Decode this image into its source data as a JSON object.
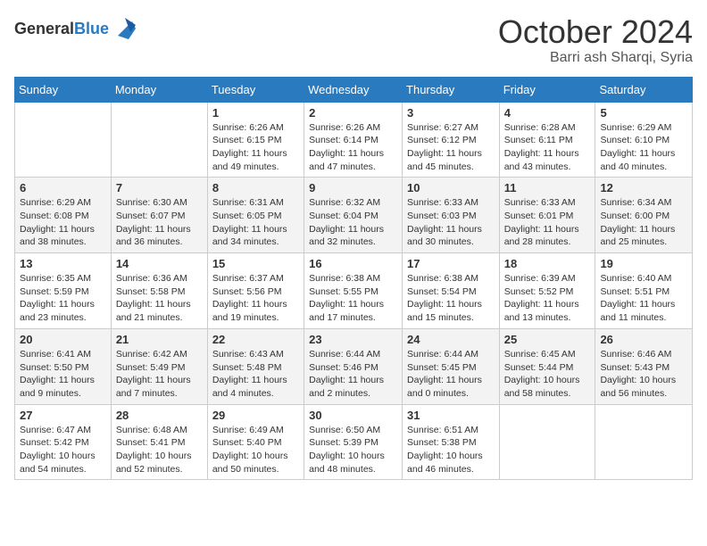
{
  "header": {
    "logo_general": "General",
    "logo_blue": "Blue",
    "month": "October 2024",
    "location": "Barri ash Sharqi, Syria"
  },
  "weekdays": [
    "Sunday",
    "Monday",
    "Tuesday",
    "Wednesday",
    "Thursday",
    "Friday",
    "Saturday"
  ],
  "weeks": [
    [
      {
        "day": null
      },
      {
        "day": null
      },
      {
        "day": 1,
        "sunrise": "Sunrise: 6:26 AM",
        "sunset": "Sunset: 6:15 PM",
        "daylight": "Daylight: 11 hours and 49 minutes."
      },
      {
        "day": 2,
        "sunrise": "Sunrise: 6:26 AM",
        "sunset": "Sunset: 6:14 PM",
        "daylight": "Daylight: 11 hours and 47 minutes."
      },
      {
        "day": 3,
        "sunrise": "Sunrise: 6:27 AM",
        "sunset": "Sunset: 6:12 PM",
        "daylight": "Daylight: 11 hours and 45 minutes."
      },
      {
        "day": 4,
        "sunrise": "Sunrise: 6:28 AM",
        "sunset": "Sunset: 6:11 PM",
        "daylight": "Daylight: 11 hours and 43 minutes."
      },
      {
        "day": 5,
        "sunrise": "Sunrise: 6:29 AM",
        "sunset": "Sunset: 6:10 PM",
        "daylight": "Daylight: 11 hours and 40 minutes."
      }
    ],
    [
      {
        "day": 6,
        "sunrise": "Sunrise: 6:29 AM",
        "sunset": "Sunset: 6:08 PM",
        "daylight": "Daylight: 11 hours and 38 minutes."
      },
      {
        "day": 7,
        "sunrise": "Sunrise: 6:30 AM",
        "sunset": "Sunset: 6:07 PM",
        "daylight": "Daylight: 11 hours and 36 minutes."
      },
      {
        "day": 8,
        "sunrise": "Sunrise: 6:31 AM",
        "sunset": "Sunset: 6:05 PM",
        "daylight": "Daylight: 11 hours and 34 minutes."
      },
      {
        "day": 9,
        "sunrise": "Sunrise: 6:32 AM",
        "sunset": "Sunset: 6:04 PM",
        "daylight": "Daylight: 11 hours and 32 minutes."
      },
      {
        "day": 10,
        "sunrise": "Sunrise: 6:33 AM",
        "sunset": "Sunset: 6:03 PM",
        "daylight": "Daylight: 11 hours and 30 minutes."
      },
      {
        "day": 11,
        "sunrise": "Sunrise: 6:33 AM",
        "sunset": "Sunset: 6:01 PM",
        "daylight": "Daylight: 11 hours and 28 minutes."
      },
      {
        "day": 12,
        "sunrise": "Sunrise: 6:34 AM",
        "sunset": "Sunset: 6:00 PM",
        "daylight": "Daylight: 11 hours and 25 minutes."
      }
    ],
    [
      {
        "day": 13,
        "sunrise": "Sunrise: 6:35 AM",
        "sunset": "Sunset: 5:59 PM",
        "daylight": "Daylight: 11 hours and 23 minutes."
      },
      {
        "day": 14,
        "sunrise": "Sunrise: 6:36 AM",
        "sunset": "Sunset: 5:58 PM",
        "daylight": "Daylight: 11 hours and 21 minutes."
      },
      {
        "day": 15,
        "sunrise": "Sunrise: 6:37 AM",
        "sunset": "Sunset: 5:56 PM",
        "daylight": "Daylight: 11 hours and 19 minutes."
      },
      {
        "day": 16,
        "sunrise": "Sunrise: 6:38 AM",
        "sunset": "Sunset: 5:55 PM",
        "daylight": "Daylight: 11 hours and 17 minutes."
      },
      {
        "day": 17,
        "sunrise": "Sunrise: 6:38 AM",
        "sunset": "Sunset: 5:54 PM",
        "daylight": "Daylight: 11 hours and 15 minutes."
      },
      {
        "day": 18,
        "sunrise": "Sunrise: 6:39 AM",
        "sunset": "Sunset: 5:52 PM",
        "daylight": "Daylight: 11 hours and 13 minutes."
      },
      {
        "day": 19,
        "sunrise": "Sunrise: 6:40 AM",
        "sunset": "Sunset: 5:51 PM",
        "daylight": "Daylight: 11 hours and 11 minutes."
      }
    ],
    [
      {
        "day": 20,
        "sunrise": "Sunrise: 6:41 AM",
        "sunset": "Sunset: 5:50 PM",
        "daylight": "Daylight: 11 hours and 9 minutes."
      },
      {
        "day": 21,
        "sunrise": "Sunrise: 6:42 AM",
        "sunset": "Sunset: 5:49 PM",
        "daylight": "Daylight: 11 hours and 7 minutes."
      },
      {
        "day": 22,
        "sunrise": "Sunrise: 6:43 AM",
        "sunset": "Sunset: 5:48 PM",
        "daylight": "Daylight: 11 hours and 4 minutes."
      },
      {
        "day": 23,
        "sunrise": "Sunrise: 6:44 AM",
        "sunset": "Sunset: 5:46 PM",
        "daylight": "Daylight: 11 hours and 2 minutes."
      },
      {
        "day": 24,
        "sunrise": "Sunrise: 6:44 AM",
        "sunset": "Sunset: 5:45 PM",
        "daylight": "Daylight: 11 hours and 0 minutes."
      },
      {
        "day": 25,
        "sunrise": "Sunrise: 6:45 AM",
        "sunset": "Sunset: 5:44 PM",
        "daylight": "Daylight: 10 hours and 58 minutes."
      },
      {
        "day": 26,
        "sunrise": "Sunrise: 6:46 AM",
        "sunset": "Sunset: 5:43 PM",
        "daylight": "Daylight: 10 hours and 56 minutes."
      }
    ],
    [
      {
        "day": 27,
        "sunrise": "Sunrise: 6:47 AM",
        "sunset": "Sunset: 5:42 PM",
        "daylight": "Daylight: 10 hours and 54 minutes."
      },
      {
        "day": 28,
        "sunrise": "Sunrise: 6:48 AM",
        "sunset": "Sunset: 5:41 PM",
        "daylight": "Daylight: 10 hours and 52 minutes."
      },
      {
        "day": 29,
        "sunrise": "Sunrise: 6:49 AM",
        "sunset": "Sunset: 5:40 PM",
        "daylight": "Daylight: 10 hours and 50 minutes."
      },
      {
        "day": 30,
        "sunrise": "Sunrise: 6:50 AM",
        "sunset": "Sunset: 5:39 PM",
        "daylight": "Daylight: 10 hours and 48 minutes."
      },
      {
        "day": 31,
        "sunrise": "Sunrise: 6:51 AM",
        "sunset": "Sunset: 5:38 PM",
        "daylight": "Daylight: 10 hours and 46 minutes."
      },
      {
        "day": null
      },
      {
        "day": null
      }
    ]
  ]
}
